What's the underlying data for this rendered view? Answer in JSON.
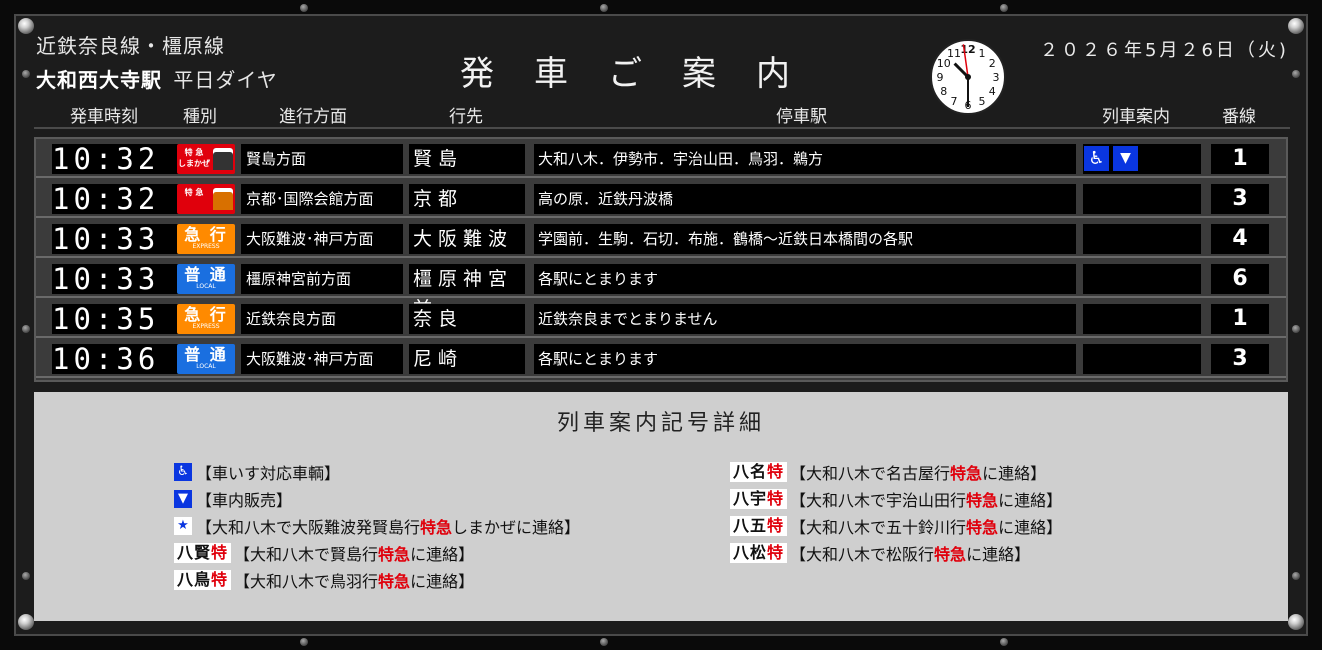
{
  "header": {
    "line": "近鉄奈良線・橿原線",
    "station": "大和西大寺駅",
    "schedule": "平日ダイヤ",
    "title": "発車ご案内",
    "date": "２０２６年5月２6日（火)"
  },
  "clock": {
    "numerals": [
      "12",
      "1",
      "2",
      "3",
      "4",
      "5",
      "6",
      "7",
      "8",
      "9",
      "10",
      "11"
    ],
    "hour": 10,
    "minute": 30
  },
  "columns": {
    "time": "発車時刻",
    "type": "種別",
    "direction": "進行方面",
    "destination": "行先",
    "stops": "停車駅",
    "info": "列車案内",
    "platform": "番線"
  },
  "trains": [
    {
      "time": "10:32",
      "type": "特急 しまかぜ",
      "type_top": "特 急",
      "type_sub": "しまかぜ",
      "type_style": "shimakaze",
      "direction": "賢島方面",
      "destination": "賢島",
      "stops": "大和八木．伊勢市．宇治山田．鳥羽．鵜方",
      "info": [
        "wheelchair-icon",
        "vending-icon"
      ],
      "platform": "1"
    },
    {
      "time": "10:32",
      "type": "特急 スナックカー",
      "type_top": "特 急",
      "type_sub": "",
      "type_style": "limited",
      "direction": "京都･国際会館方面",
      "destination": "京都",
      "stops": "高の原．近鉄丹波橋",
      "info": [],
      "platform": "3"
    },
    {
      "time": "10:33",
      "type": "急行",
      "type_top": "急 行",
      "type_sub": "EXPRESS",
      "type_style": "express",
      "direction": "大阪難波･神戸方面",
      "destination": "大阪難波",
      "stops": "学園前．生駒．石切．布施．鶴橋～近鉄日本橋間の各駅",
      "info": [],
      "platform": "4"
    },
    {
      "time": "10:33",
      "type": "普通",
      "type_top": "普 通",
      "type_sub": "LOCAL",
      "type_style": "local",
      "direction": "橿原神宮前方面",
      "destination": "橿原神宮前",
      "stops": "各駅にとまります",
      "info": [],
      "platform": "6"
    },
    {
      "time": "10:35",
      "type": "急行",
      "type_top": "急 行",
      "type_sub": "EXPRESS",
      "type_style": "express",
      "direction": "近鉄奈良方面",
      "destination": "奈良",
      "stops": "近鉄奈良までとまりません",
      "info": [],
      "platform": "1"
    },
    {
      "time": "10:36",
      "type": "普通",
      "type_top": "普 通",
      "type_sub": "LOCAL",
      "type_style": "local",
      "direction": "大阪難波･神戸方面",
      "destination": "尼崎",
      "stops": "各駅にとまります",
      "info": [],
      "platform": "3"
    }
  ],
  "legend": {
    "title": "列車案内記号詳細",
    "left": [
      {
        "badge": "wheelchair",
        "text": "【車いす対応車輌】"
      },
      {
        "badge": "vending",
        "text": "【車内販売】"
      },
      {
        "badge": "star",
        "text": "【大和八木で大阪難波発賢島行",
        "red": "特急",
        "text2": "しまかぜに連絡】"
      },
      {
        "badge": "八賢",
        "badge_red": "特",
        "text": "【大和八木で賢島行",
        "red": "特急",
        "text2": "に連絡】"
      },
      {
        "badge": "八鳥",
        "badge_red": "特",
        "text": "【大和八木で鳥羽行",
        "red": "特急",
        "text2": "に連絡】"
      }
    ],
    "right": [
      {
        "badge": "八名",
        "badge_red": "特",
        "text": "【大和八木で名古屋行",
        "red": "特急",
        "text2": "に連絡】"
      },
      {
        "badge": "八宇",
        "badge_red": "特",
        "text": "【大和八木で宇治山田行",
        "red": "特急",
        "text2": "に連絡】"
      },
      {
        "badge": "八五",
        "badge_red": "特",
        "text": "【大和八木で五十鈴川行",
        "red": "特急",
        "text2": "に連絡】"
      },
      {
        "badge": "八松",
        "badge_red": "特",
        "text": "【大和八木で松阪行",
        "red": "特急",
        "text2": "に連絡】"
      }
    ]
  },
  "colors": {
    "express": "#ff8a00",
    "local": "#1a6fe0",
    "limited": "#e0000c",
    "accent_blue": "#0a36e0"
  }
}
